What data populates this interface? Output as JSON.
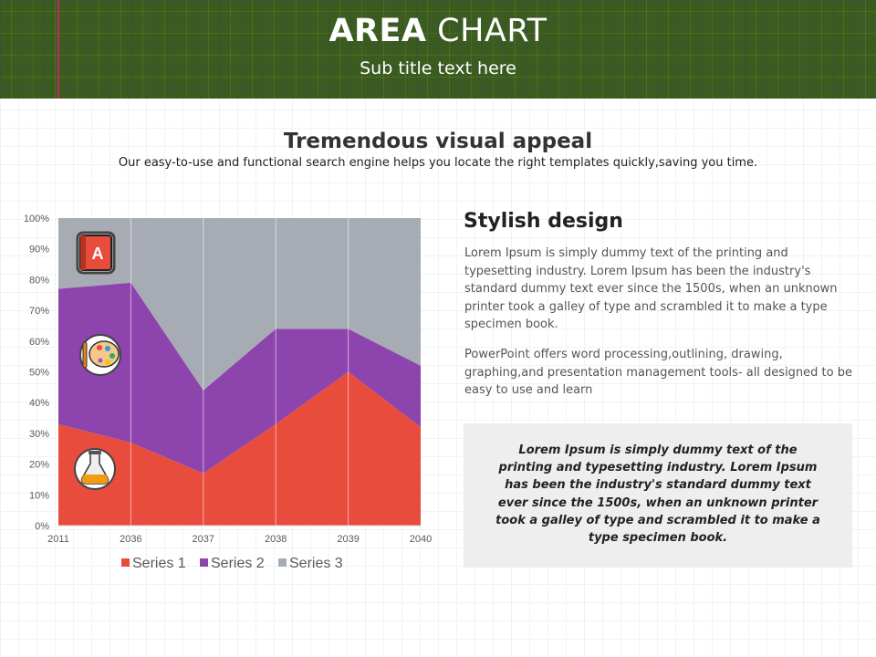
{
  "header": {
    "title_bold": "AREA",
    "title_light": "CHART",
    "subtitle": "Sub title text here"
  },
  "section": {
    "title": "Tremendous visual appeal",
    "description": "Our easy-to-use and functional search engine helps you locate the right templates quickly,saving you time."
  },
  "right": {
    "title": "Stylish design",
    "paragraph1": "Lorem Ipsum is simply dummy text of the printing and typesetting industry. Lorem Ipsum has been the industry's standard dummy text ever since the 1500s, when an unknown printer took a galley of type and scrambled it to make a type specimen book.",
    "paragraph2": "PowerPoint offers word processing,outlining, drawing, graphing,and presentation management tools- all designed to be easy to use and learn",
    "quote": "Lorem Ipsum is simply dummy text of the printing and typesetting industry. Lorem Ipsum has been the industry's standard dummy text ever since the 1500s, when an unknown printer took a galley of type and scrambled it to make a type specimen book."
  },
  "icons": [
    "book-a-icon",
    "palette-icon",
    "flask-icon"
  ],
  "chart_data": {
    "type": "area",
    "stacked": true,
    "percent": true,
    "categories": [
      "2011",
      "2036",
      "2037",
      "2038",
      "2039",
      "2040"
    ],
    "series": [
      {
        "name": "Series 1",
        "color": "#e84c3d",
        "values": [
          33,
          27,
          17,
          33,
          50,
          32
        ]
      },
      {
        "name": "Series 2",
        "color": "#8e44ad",
        "values": [
          44,
          52,
          27,
          31,
          14,
          20
        ]
      },
      {
        "name": "Series 3",
        "color": "#a7abb4",
        "values": [
          23,
          21,
          56,
          36,
          36,
          48
        ]
      }
    ],
    "y_ticks": [
      "0%",
      "10%",
      "20%",
      "30%",
      "40%",
      "50%",
      "60%",
      "70%",
      "80%",
      "90%",
      "100%"
    ],
    "ylim": [
      0,
      100
    ],
    "grid": "vertical",
    "legend": "bottom"
  }
}
